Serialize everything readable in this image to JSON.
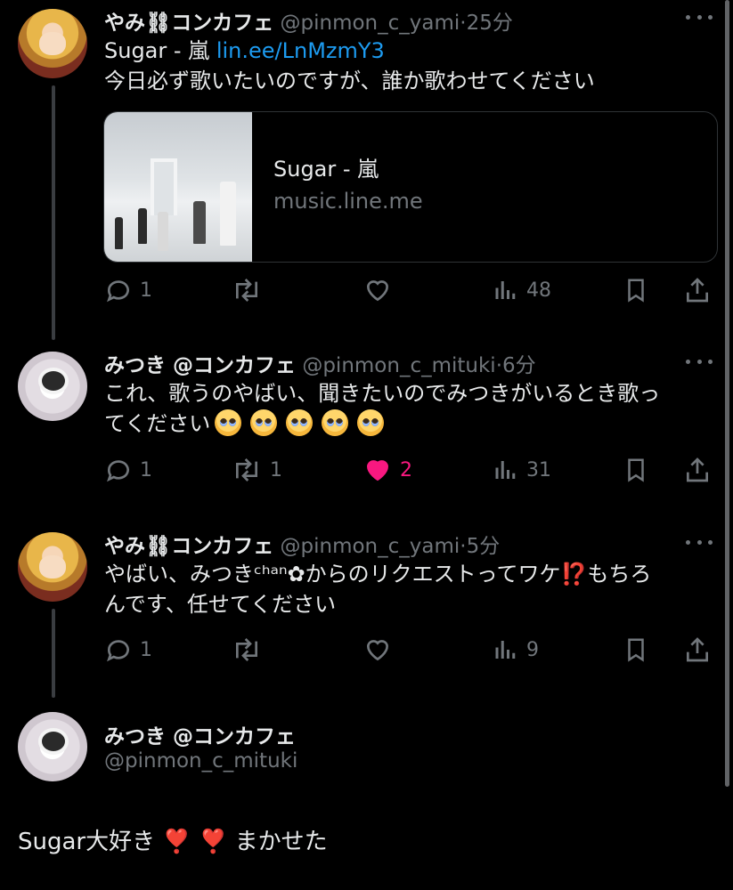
{
  "tweets": [
    {
      "name": "やみ⛓コンカフェ",
      "handle": "@pinmon_c_yami",
      "separator": "·",
      "time": "25分",
      "text_prefix": "Sugar - 嵐 ",
      "link": "lin.ee/LnMzmY3",
      "text_line2": "今日必ず歌いたいのですが、誰か歌わせてください",
      "card": {
        "title": "Sugar - 嵐",
        "domain": "music.line.me"
      },
      "replies": "1",
      "retweets": "",
      "likes": "",
      "views": "48"
    },
    {
      "name": "みつき @コンカフェ",
      "handle": "@pinmon_c_mituki",
      "separator": "·",
      "time": "6分",
      "text_line1": "これ、歌うのやばい、聞きたいのでみつきがいるとき歌っ",
      "text_line2": "てください",
      "emojis": [
        "🥺",
        "🥺",
        "🥺",
        "🥺",
        "🥺"
      ],
      "replies": "1",
      "retweets": "1",
      "likes": "2",
      "views": "31"
    },
    {
      "name": "やみ⛓コンカフェ",
      "handle": "@pinmon_c_yami",
      "separator": "·",
      "time": "5分",
      "text_line1": "やばい、みつきᶜʰᵃⁿ✿からのリクエストってワケ⁉️もちろ",
      "text_line2": "んです、任せてください",
      "replies": "1",
      "retweets": "",
      "likes": "",
      "views": "9"
    }
  ],
  "composer": {
    "name": "みつき @コンカフェ",
    "handle": "@pinmon_c_mituki",
    "reply_text": "Sugar大好き ❣️ ❣️ まかせた"
  },
  "colors": {
    "accent": "#1d9bf0",
    "like": "#f91880",
    "muted": "#71767b",
    "background": "#000000"
  },
  "icons": [
    "reply-icon",
    "retweet-icon",
    "like-icon",
    "views-icon",
    "bookmark-icon",
    "share-icon",
    "more-icon"
  ]
}
